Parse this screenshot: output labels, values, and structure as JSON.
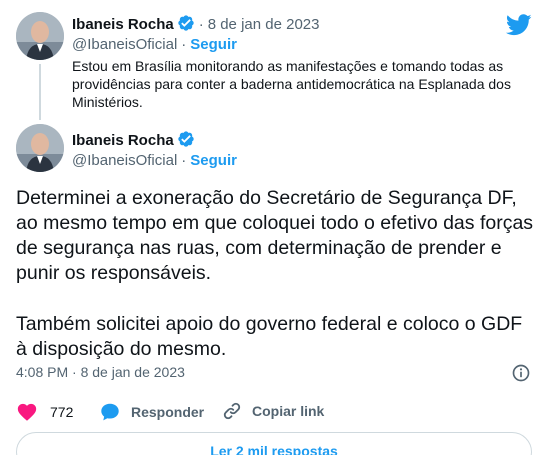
{
  "parent_tweet": {
    "author_name": "Ibaneis Rocha",
    "handle": "@IbaneisOficial",
    "follow_label": "Seguir",
    "date": "8 de jan de 2023",
    "text": "Estou em Brasília monitorando as manifestações e tomando todas as providências para conter a baderna antidemocrática na Esplanada dos Ministérios."
  },
  "main_tweet": {
    "author_name": "Ibaneis Rocha",
    "handle": "@IbaneisOficial",
    "follow_label": "Seguir",
    "text_paragraph_1": "Determinei a exoneração do Secretário de Segurança DF, ao mesmo tempo em que coloquei todo o efetivo das forças de segurança nas ruas, com determinação de prender e punir os responsáveis.",
    "text_paragraph_2": "Também solicitei apoio do governo federal e coloco o GDF à disposição do mesmo.",
    "timestamp": "4:08 PM · 8 de jan de 2023"
  },
  "actions": {
    "like_count": "772",
    "reply_label": "Responder",
    "copy_link_label": "Copiar link"
  },
  "read_replies_label": "Ler 2 mil respostas",
  "colors": {
    "accent": "#1d9bf0",
    "like": "#f91880",
    "muted": "#536471"
  },
  "icons": [
    "twitter-bird-icon",
    "verified-badge-icon",
    "info-icon",
    "heart-icon",
    "reply-bubble-icon",
    "link-icon"
  ]
}
